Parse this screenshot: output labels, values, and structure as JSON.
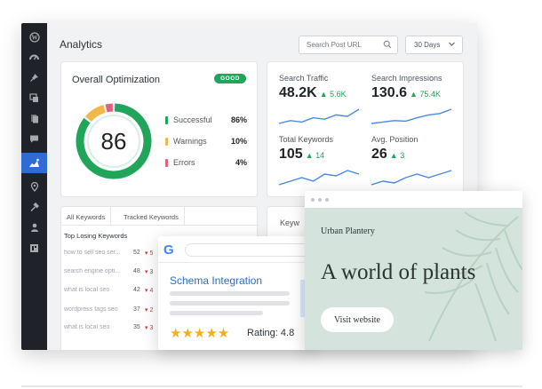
{
  "header": {
    "title": "Analytics",
    "search_placeholder": "Search Post URL",
    "range": "30 Days"
  },
  "sidebar": {
    "icons": [
      "wordpress-icon",
      "dashboard-icon",
      "pin-icon",
      "media-icon",
      "pages-icon",
      "comments-icon",
      "rank-math-icon",
      "location-icon",
      "tools-icon",
      "user-icon",
      "settings-icon"
    ],
    "active_index": 6
  },
  "optimization": {
    "title": "Overall Optimization",
    "badge": "GOOD",
    "score": "86",
    "score_value": 86,
    "legend": [
      {
        "label": "Successful",
        "pct": "86%",
        "value": 86,
        "color": "#21a55a"
      },
      {
        "label": "Warnings",
        "pct": "10%",
        "value": 10,
        "color": "#f0b849"
      },
      {
        "label": "Errors",
        "pct": "4%",
        "value": 4,
        "color": "#e2607a"
      }
    ]
  },
  "stats": [
    {
      "label": "Search Traffic",
      "value": "48.2K",
      "change": "▲ 5.6K",
      "trend": [
        3,
        4,
        3.5,
        5,
        4.5,
        6,
        5.5,
        8
      ]
    },
    {
      "label": "Search Impressions",
      "value": "130.6",
      "change": "▲ 75.4K",
      "trend": [
        3,
        3.5,
        4,
        3.8,
        5,
        6,
        6.5,
        8
      ]
    },
    {
      "label": "Total Keywords",
      "value": "105",
      "change": "▲ 14",
      "trend": [
        2,
        3,
        4,
        3,
        5,
        4.5,
        6,
        5
      ]
    },
    {
      "label": "Avg. Position",
      "value": "26",
      "change": "▲ 3",
      "trend": [
        2,
        3,
        2.5,
        4,
        5,
        4,
        5,
        6
      ]
    }
  ],
  "keywords": {
    "tabs": [
      "All Keywords",
      "Tracked Keywords"
    ],
    "heading": "Top Losing Keywords",
    "rows": [
      {
        "term": "how to sell seo ser...",
        "pos": "52",
        "chg": "▾ 5"
      },
      {
        "term": "search engine opti...",
        "pos": "48",
        "chg": "▾ 3"
      },
      {
        "term": "what is local seo",
        "pos": "42",
        "chg": "▾ 4"
      },
      {
        "term": "wordpress tags seo",
        "pos": "37",
        "chg": "▾ 2"
      },
      {
        "term": "what is local seo",
        "pos": "35",
        "chg": "▾ 3"
      }
    ]
  },
  "keywords_card2": {
    "title": "Keyw"
  },
  "google_card": {
    "logo": "G",
    "title": "Schema Integration",
    "stars": "★★★★★",
    "rating": "Rating: 4.8"
  },
  "site_card": {
    "brand": "Urban Plantery",
    "hero": "A world of plants",
    "button": "Visit website"
  },
  "colors": {
    "accent": "#2f6bd3",
    "good": "#21a55a",
    "warn": "#f0b849",
    "error": "#e2607a",
    "line": "#4a8be0"
  }
}
